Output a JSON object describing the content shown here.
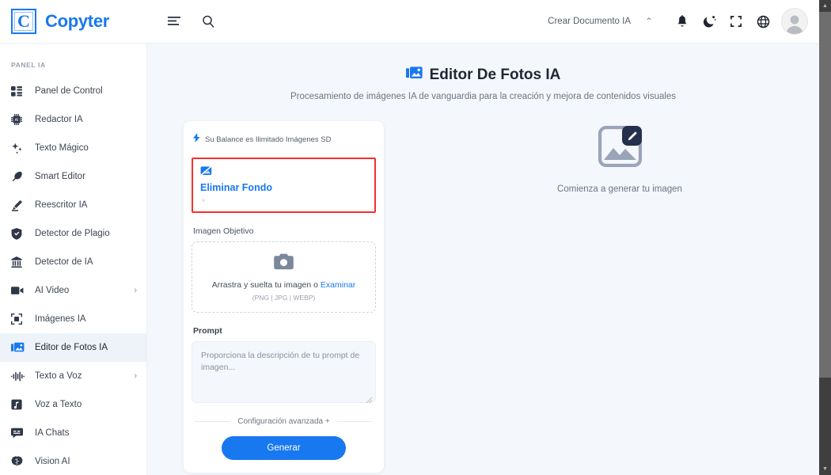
{
  "brand": {
    "logo_letter": "C",
    "name": "Copyter",
    "logo_color": "#1878f0"
  },
  "header": {
    "left_icons": [
      {
        "name": "menu-align-icon",
        "label": "Menú"
      },
      {
        "name": "search-icon",
        "label": "Buscar"
      }
    ],
    "create_document_label": "Crear Documento IA",
    "create_document_caret": "⌃",
    "right_icons": [
      {
        "name": "bell-icon",
        "label": "Notificaciones"
      },
      {
        "name": "moon-icon",
        "label": "Modo oscuro"
      },
      {
        "name": "fullscreen-icon",
        "label": "Pantalla completa"
      },
      {
        "name": "globe-icon",
        "label": "Idioma"
      }
    ],
    "avatar_label": "Perfil"
  },
  "sidebar": {
    "heading": "PANEL IA",
    "items": [
      {
        "label": "Panel de Control",
        "icon": "dashboard-icon",
        "active": false,
        "arrow": ""
      },
      {
        "label": "Redactor IA",
        "icon": "chip-ai-icon",
        "active": false,
        "arrow": ""
      },
      {
        "label": "Texto Mágico",
        "icon": "sparkles-icon",
        "active": false,
        "arrow": ""
      },
      {
        "label": "Smart Editor",
        "icon": "feather-icon",
        "active": false,
        "arrow": ""
      },
      {
        "label": "Reescritor IA",
        "icon": "pencil-icon",
        "active": false,
        "arrow": ""
      },
      {
        "label": "Detector de Plagio",
        "icon": "shield-check-icon",
        "active": false,
        "arrow": ""
      },
      {
        "label": "Detector de IA",
        "icon": "bank-scan-icon",
        "active": false,
        "arrow": ""
      },
      {
        "label": "AI Video",
        "icon": "video-camera-icon",
        "active": false,
        "arrow": "›"
      },
      {
        "label": "Imágenes IA",
        "icon": "image-frame-icon",
        "active": false,
        "arrow": ""
      },
      {
        "label": "Editor de Fotos IA",
        "icon": "photo-edit-icon",
        "active": true,
        "arrow": ""
      },
      {
        "label": "Texto a Voz",
        "icon": "waveform-icon",
        "active": false,
        "arrow": "›"
      },
      {
        "label": "Voz a Texto",
        "icon": "audio-note-icon",
        "active": false,
        "arrow": ""
      },
      {
        "label": "IA Chats",
        "icon": "chat-bubble-icon",
        "active": false,
        "arrow": ""
      },
      {
        "label": "Vision AI",
        "icon": "brain-icon",
        "active": false,
        "arrow": ""
      }
    ]
  },
  "page": {
    "title": "Editor De Fotos IA",
    "title_icon": "photo-edit-icon",
    "subtitle": "Procesamiento de imágenes IA de vanguardia para la creación y mejora de contenidos visuales"
  },
  "panel": {
    "balance": {
      "icon": "lightning-bolt-icon",
      "text": "Su Balance es Ilimitado Imágenes SD"
    },
    "tool_selector": {
      "icon": "image-slash-icon",
      "label": "Eliminar Fondo",
      "caret": "▾",
      "highlight_color": "#f3302e"
    },
    "target_image": {
      "label": "Imagen Objetivo",
      "icon": "camera-icon",
      "drop_text": "Arrastra y suelta tu imagen o ",
      "browse_link": "Examinar",
      "formats": "(PNG | JPG | WEBP)"
    },
    "prompt": {
      "label": "Prompt",
      "placeholder": "Proporciona la descripción de tu prompt de imagen...",
      "value": ""
    },
    "advanced_settings_label": "Configuración avanzada +",
    "generate_button": "Generar",
    "accent_color": "#1878f0"
  },
  "preview": {
    "icon": "image-edit-placeholder-icon",
    "caption": "Comienza a generar tu imagen"
  },
  "scrollbar": {
    "up_arrow": "▲",
    "down_arrow": "▼"
  }
}
